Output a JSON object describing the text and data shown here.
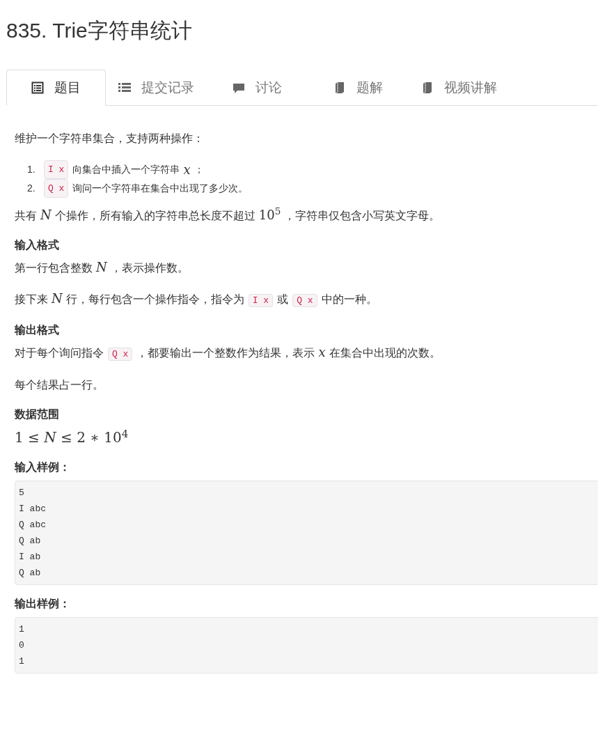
{
  "title": "835. Trie字符串统计",
  "tabs": [
    {
      "label": "题目",
      "selected": true,
      "kind": "statement"
    },
    {
      "label": "提交记录",
      "selected": false,
      "kind": "submissions"
    },
    {
      "label": "讨论",
      "selected": false,
      "kind": "discussion"
    },
    {
      "label": "题解",
      "selected": false,
      "kind": "solutions"
    },
    {
      "label": "视频讲解",
      "selected": false,
      "kind": "video"
    }
  ],
  "blocks": [
    {
      "kind": "para",
      "segments": [
        {
          "kind": "text",
          "text": "维护一个字符串集合，支持两种操作："
        }
      ]
    },
    {
      "kind": "list",
      "items": [
        {
          "number": "1.",
          "segments": [
            {
              "kind": "code",
              "text": "I x"
            },
            {
              "kind": "text",
              "text": "向集合中插入一个字符串"
            },
            {
              "kind": "math",
              "text": "*x*"
            },
            {
              "kind": "text",
              "text": "；"
            }
          ]
        },
        {
          "number": "2.",
          "segments": [
            {
              "kind": "code",
              "text": "Q x"
            },
            {
              "kind": "text",
              "text": "询问一个字符串在集合中出现了多少次。"
            }
          ]
        }
      ]
    },
    {
      "kind": "para",
      "segments": [
        {
          "kind": "text",
          "text": "共有"
        },
        {
          "kind": "math",
          "text": "*N*"
        },
        {
          "kind": "text",
          "text": "个操作，所有输入的字符串总长度不超过"
        },
        {
          "kind": "math",
          "text": "10$^{5}$"
        },
        {
          "kind": "text",
          "text": "，字符串仅包含小写英文字母。"
        }
      ]
    },
    {
      "kind": "heading",
      "text": "输入格式"
    },
    {
      "kind": "para",
      "segments": [
        {
          "kind": "text",
          "text": "第一行包含整数"
        },
        {
          "kind": "math",
          "text": "*N*"
        },
        {
          "kind": "text",
          "text": "，表示操作数。"
        }
      ]
    },
    {
      "kind": "para",
      "segments": [
        {
          "kind": "text",
          "text": "接下来"
        },
        {
          "kind": "math",
          "text": "*N*"
        },
        {
          "kind": "text",
          "text": "行，每行包含一个操作指令，指令为"
        },
        {
          "kind": "code",
          "text": "I x"
        },
        {
          "kind": "text",
          "text": "或"
        },
        {
          "kind": "code",
          "text": "Q x"
        },
        {
          "kind": "text",
          "text": "中的一种。"
        }
      ]
    },
    {
      "kind": "heading",
      "text": "输出格式"
    },
    {
      "kind": "para",
      "segments": [
        {
          "kind": "text",
          "text": "对于每个询问指令"
        },
        {
          "kind": "code",
          "text": "Q x"
        },
        {
          "kind": "text",
          "text": "，都要输出一个整数作为结果，表示"
        },
        {
          "kind": "math",
          "text": "*x*"
        },
        {
          "kind": "text",
          "text": "在集合中出现的次数。"
        }
      ]
    },
    {
      "kind": "para",
      "segments": [
        {
          "kind": "text",
          "text": "每个结果占一行。"
        }
      ]
    },
    {
      "kind": "heading",
      "text": "数据范围"
    },
    {
      "kind": "formula",
      "text": "1 ≤ *N* ≤ 2 ∗ 10$^{4}$"
    },
    {
      "kind": "heading",
      "text": "输入样例："
    },
    {
      "kind": "pre",
      "lines": [
        "5",
        "I abc",
        "Q abc",
        "Q ab",
        "I ab",
        "Q ab"
      ]
    },
    {
      "kind": "heading",
      "text": "输出样例："
    },
    {
      "kind": "pre",
      "lines": [
        "1",
        "0",
        "1"
      ]
    }
  ]
}
